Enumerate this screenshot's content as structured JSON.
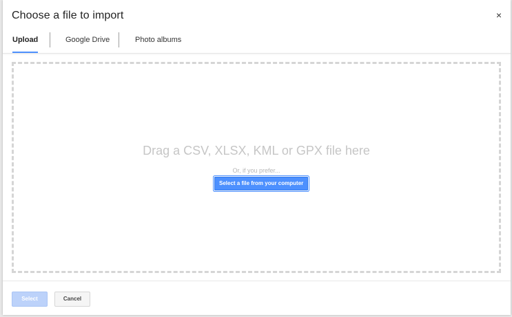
{
  "dialog": {
    "title": "Choose a file to import",
    "close_icon_glyph": "×"
  },
  "tabs": [
    {
      "label": "Upload",
      "active": true
    },
    {
      "label": "Google Drive",
      "active": false
    },
    {
      "label": "Photo albums",
      "active": false
    }
  ],
  "dropzone": {
    "headline": "Drag a CSV, XLSX, KML or GPX file here",
    "alt_text": "Or, if you prefer...",
    "select_button_label": "Select a file from your computer"
  },
  "footer": {
    "select_label": "Select",
    "cancel_label": "Cancel"
  },
  "colors": {
    "accent": "#4d90fe",
    "disabled_primary": "#bcd2fa"
  }
}
